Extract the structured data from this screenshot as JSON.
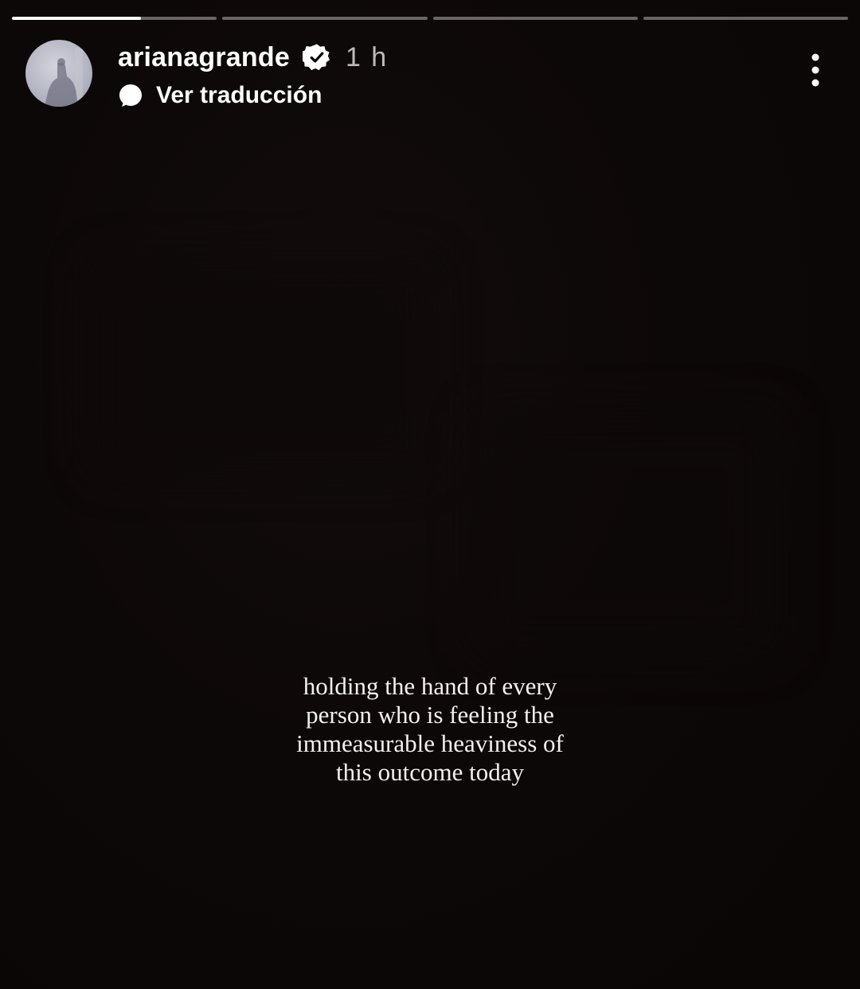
{
  "story": {
    "progress": [
      0.63,
      0,
      0,
      0
    ],
    "header": {
      "username": "arianagrande",
      "time": "1 h",
      "translate_label": "Ver traducción"
    },
    "caption_lines": [
      "holding the hand of every",
      "person who is feeling the",
      "immeasurable heaviness of",
      "this outcome today"
    ]
  },
  "icons": {
    "verified": "verified-badge-icon",
    "translate": "speech-bubble-icon",
    "more": "more-options-icon"
  },
  "colors": {
    "background": "#0c0707",
    "text": "#ffffff",
    "progress_track": "rgba(255,255,255,0.38)"
  }
}
